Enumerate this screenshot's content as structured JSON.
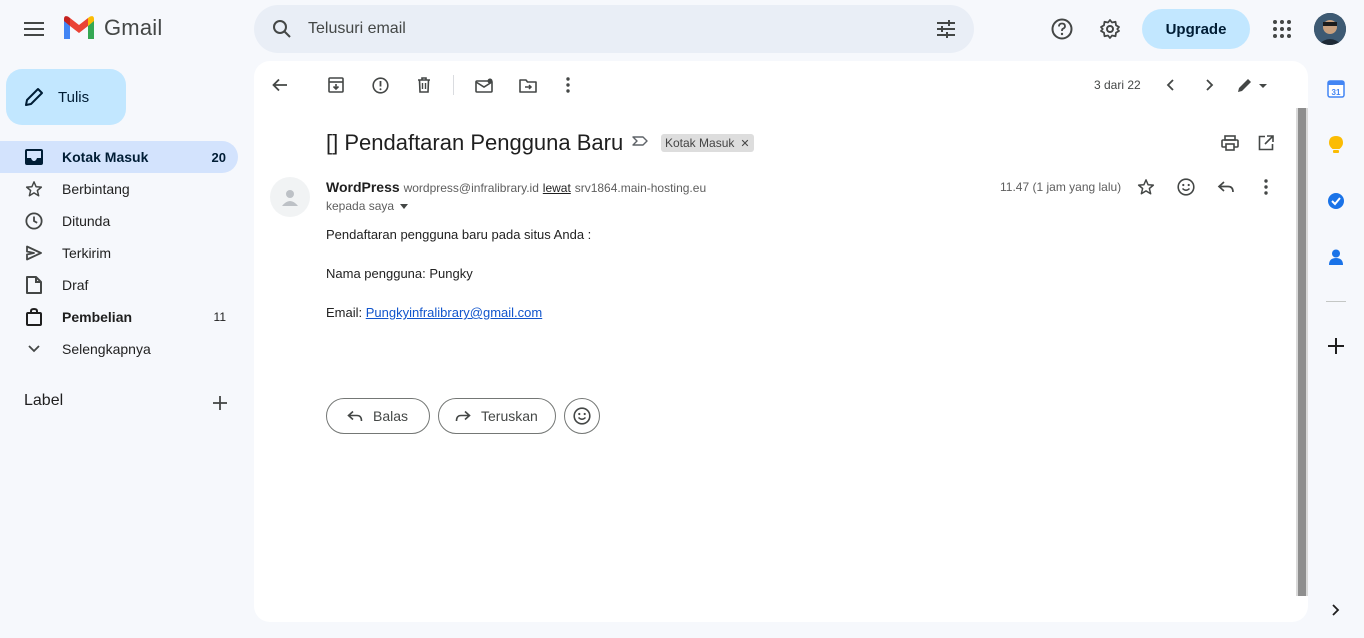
{
  "app": {
    "name": "Gmail"
  },
  "search": {
    "placeholder": "Telusuri email"
  },
  "topbar": {
    "upgrade_label": "Upgrade"
  },
  "compose": {
    "label": "Tulis"
  },
  "nav": [
    {
      "label": "Kotak Masuk",
      "count": "20"
    },
    {
      "label": "Berbintang",
      "count": ""
    },
    {
      "label": "Ditunda",
      "count": ""
    },
    {
      "label": "Terkirim",
      "count": ""
    },
    {
      "label": "Draf",
      "count": ""
    },
    {
      "label": "Pembelian",
      "count": "11"
    },
    {
      "label": "Selengkapnya",
      "count": ""
    }
  ],
  "labels": {
    "heading": "Label"
  },
  "toolbar": {
    "pager": "3 dari 22"
  },
  "email": {
    "subject": "[] Pendaftaran Pengguna Baru",
    "label_chip": "Kotak Masuk",
    "sender_name": "WordPress",
    "sender_email": "wordpress@infralibrary.id",
    "via": "lewat",
    "via_host": "srv1864.main-hosting.eu",
    "to": "kepada saya",
    "time": "11.47 (1 jam yang lalu)",
    "body": {
      "line1": "Pendaftaran pengguna baru pada situs Anda :",
      "line2": "Nama pengguna: Pungky",
      "email_label": "Email: ",
      "email_link": "Pungkyinfralibrary@gmail.com"
    }
  },
  "actions": {
    "reply": "Balas",
    "forward": "Teruskan"
  },
  "side_rail": {
    "calendar_day": "31"
  },
  "colors": {
    "accent": "#c2e7ff",
    "nav_active": "#d3e3fd",
    "link": "#1155cc",
    "background": "#f6f8fc"
  },
  "icons": [
    "menu-icon",
    "search-icon",
    "tune-icon",
    "help-icon",
    "settings-icon",
    "apps-icon",
    "back-icon",
    "archive-icon",
    "spam-icon",
    "delete-icon",
    "mark-unread-icon",
    "move-icon",
    "more-icon",
    "print-icon",
    "open-new-window-icon",
    "star-icon",
    "emoji-icon",
    "reply-icon",
    "forward-icon",
    "calendar-icon",
    "keep-icon",
    "tasks-icon",
    "contacts-icon",
    "add-icon"
  ]
}
